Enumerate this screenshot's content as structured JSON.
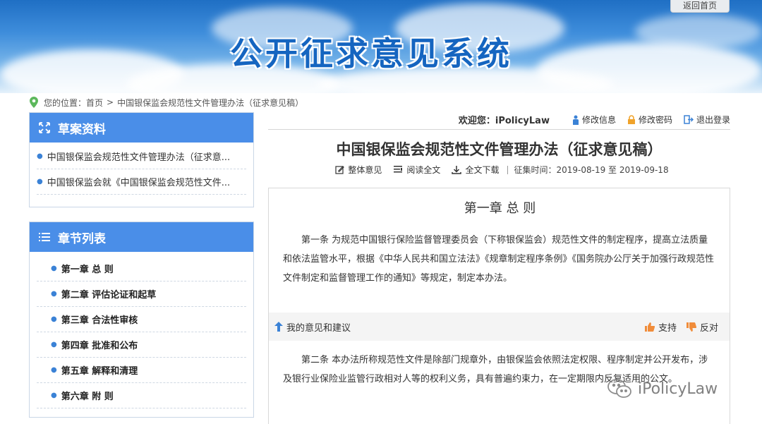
{
  "header": {
    "title": "公开征求意见系统",
    "back_home": "返回首页"
  },
  "breadcrumb": {
    "prefix": "您的位置：",
    "home": "首页",
    "separator": ">",
    "current": "中国银保监会规范性文件管理办法（征求意见稿）"
  },
  "user": {
    "welcome": "欢迎您：iPolicyLaw",
    "edit_info": "修改信息",
    "change_password": "修改密码",
    "logout": "退出登录"
  },
  "sidebar": {
    "drafts": {
      "title": "草案资料",
      "items": [
        {
          "label": "中国银保监会规范性文件管理办法（征求意..."
        },
        {
          "label": "中国银保监会就《中国银保监会规范性文件..."
        }
      ]
    },
    "chapters": {
      "title": "章节列表",
      "items": [
        {
          "label": "第一章 总 则"
        },
        {
          "label": "第二章 评估论证和起草"
        },
        {
          "label": "第三章 合法性审核"
        },
        {
          "label": "第四章 批准和公布"
        },
        {
          "label": "第五章 解释和清理"
        },
        {
          "label": "第六章 附 则"
        }
      ]
    }
  },
  "document": {
    "title": "中国银保监会规范性文件管理办法（征求意见稿）",
    "actions": {
      "overall_opinion": "整体意见",
      "read_full": "阅读全文",
      "download_full": "全文下载",
      "period_label": "征集时间：",
      "period_value": "2019-08-19 至 2019-09-18"
    },
    "chapter_heading": "第一章 总 则",
    "article1": "第一条 为规范中国银行保险监督管理委员会（下称银保监会）规范性文件的制定程序，提高立法质量和依法监管水平，根据《中华人民共和国立法法》《规章制定程序条例》《国务院办公厅关于加强行政规范性文件制定和监督管理工作的通知》等规定，制定本办法。",
    "feedback": {
      "my_opinion": "我的意见和建议",
      "support": "支持",
      "oppose": "反对"
    },
    "article2": "第二条 本办法所称规范性文件是除部门规章外，由银保监会依照法定权限、程序制定并公开发布，涉及银行业保险业监管行政相对人等的权利义务，具有普遍约束力，在一定期限内反复适用的公文。"
  },
  "watermark": {
    "text": "iPolicyLaw"
  },
  "colors": {
    "accent": "#4a8ee8",
    "title_blue": "#1565c0",
    "like_orange": "#f08c3a"
  }
}
